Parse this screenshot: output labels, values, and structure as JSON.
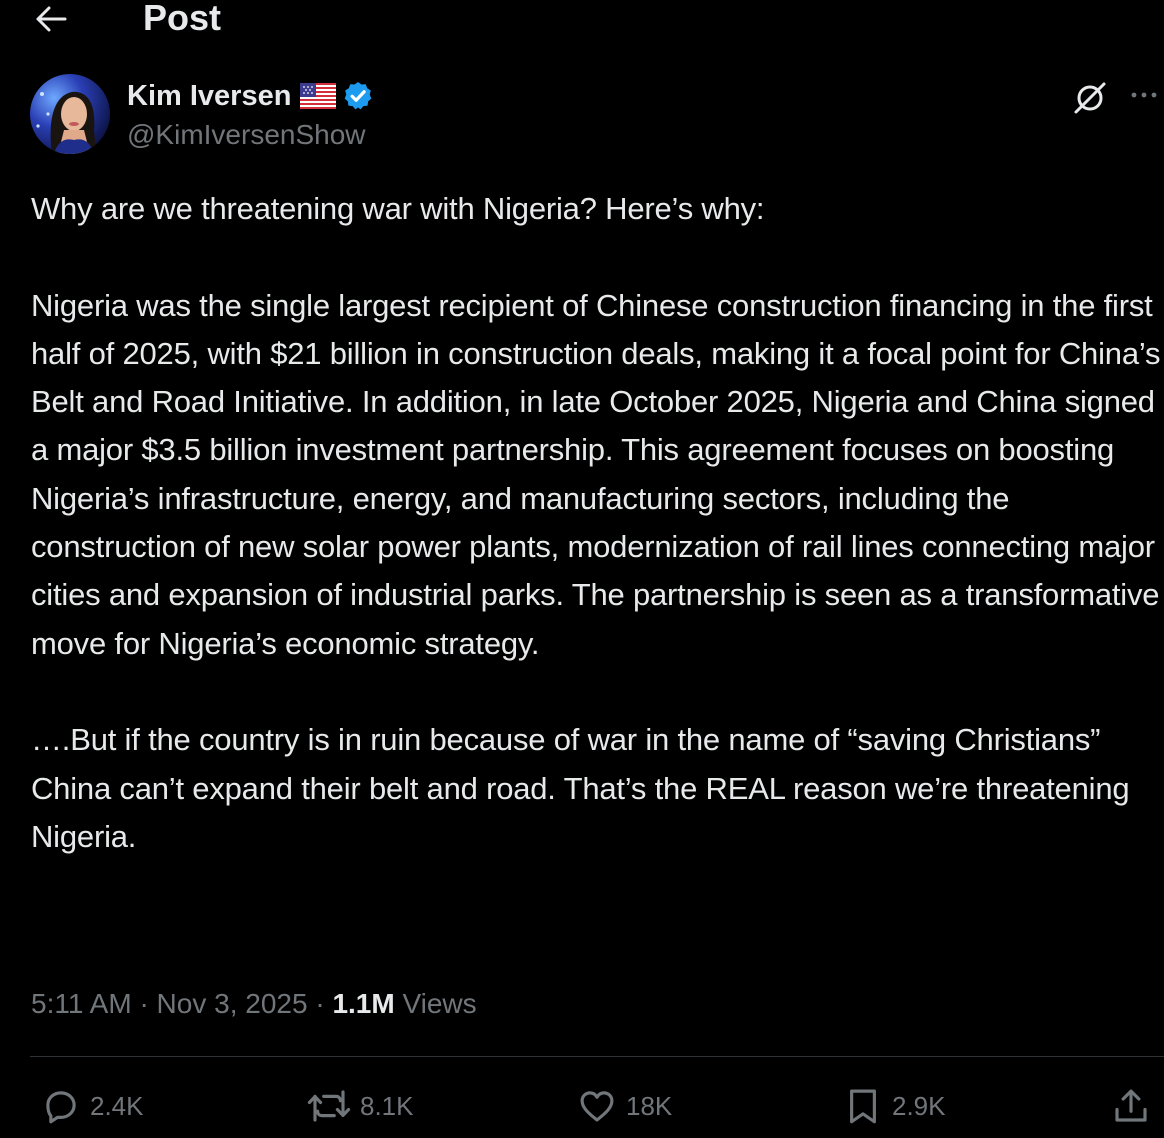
{
  "header": {
    "title": "Post"
  },
  "author": {
    "display_name": "Kim Iversen",
    "handle": "@KimIversenShow"
  },
  "post": {
    "text": "Why are we threatening war with Nigeria? Here’s why:\n\nNigeria was the single largest recipient of Chinese construction financing in the first half of 2025, with $21 billion in construction deals, making it a focal point for China’s Belt and Road Initiative. In addition, in late October 2025, Nigeria and China signed a major $3.5 billion investment partnership. This agreement focuses on boosting Nigeria’s infrastructure, energy, and manufacturing sectors, including the construction of new solar power plants, modernization of rail lines connecting major cities and expansion of industrial parks. The partnership is seen as a transformative move for Nigeria’s economic strategy.\n\n….But if the country is in ruin because of war in the name of “saving Christians” China can’t expand their belt and road. That’s the REAL reason we’re threatening Nigeria.",
    "time": "5:11 AM",
    "separator": "·",
    "date": "Nov 3, 2025",
    "views_count": "1.1M",
    "views_label": "Views"
  },
  "actions": {
    "replies": "2.4K",
    "reposts": "8.1K",
    "likes": "18K",
    "bookmarks": "2.9K"
  },
  "icons": {
    "back": "arrow-left-icon",
    "flag": "us-flag-icon",
    "verified": "verified-badge-icon",
    "grok": "grok-icon",
    "more": "more-icon",
    "reply": "reply-icon",
    "repost": "repost-icon",
    "like": "heart-icon",
    "bookmark": "bookmark-icon",
    "share": "share-icon"
  },
  "colors": {
    "background": "#000000",
    "text": "#e7e9ea",
    "secondary": "#71767b",
    "verified": "#1d9bf0",
    "divider": "#2f3336"
  }
}
